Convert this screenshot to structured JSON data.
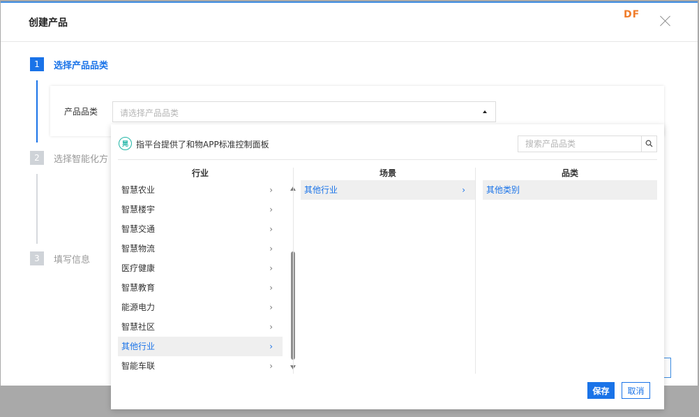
{
  "modal": {
    "title": "创建产品",
    "brand": "DF"
  },
  "steps": [
    {
      "num": "1",
      "label": "选择产品品类",
      "active": true
    },
    {
      "num": "2",
      "label": "选择智能化方",
      "active": false
    },
    {
      "num": "3",
      "label": "填写信息",
      "active": false
    }
  ],
  "form": {
    "category_label": "产品品类",
    "category_placeholder": "请选择产品品类"
  },
  "dropdown": {
    "logo_text": "晃",
    "note": "指平台提供了和物APP标准控制面板",
    "search_placeholder": "搜索产品品类",
    "columns": {
      "industry": {
        "header": "行业",
        "items": [
          "智慧农业",
          "智慧楼宇",
          "智慧交通",
          "智慧物流",
          "医疗健康",
          "智慧教育",
          "能源电力",
          "智慧社区",
          "其他行业",
          "智能车联"
        ],
        "selected_index": 8
      },
      "scene": {
        "header": "场景",
        "items": [
          "其他行业"
        ],
        "selected_index": 0
      },
      "category": {
        "header": "品类",
        "items": [
          "其他类别"
        ],
        "selected_index": 0
      }
    },
    "save_label": "保存",
    "cancel_label": "取消"
  },
  "colors": {
    "accent": "#1a73e8",
    "brand": "#f07c2a",
    "logo": "#1fb5a6"
  }
}
